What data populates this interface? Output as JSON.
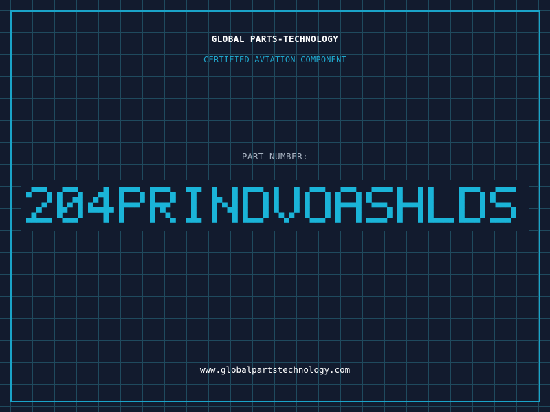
{
  "header": {
    "company": "GLOBAL PARTS-TECHNOLOGY",
    "subtitle": "CERTIFIED AVIATION COMPONENT"
  },
  "part": {
    "label": "PART NUMBER:",
    "number": "204PRINDVOASHLDS"
  },
  "footer": {
    "website": "www.globalpartstechnology.com"
  },
  "colors": {
    "background": "#121b2e",
    "grid": "#1f4a5e",
    "accent": "#1ab4d8",
    "frame": "#1aa3c8",
    "text": "#ffffff",
    "label": "#a9b4c2"
  }
}
